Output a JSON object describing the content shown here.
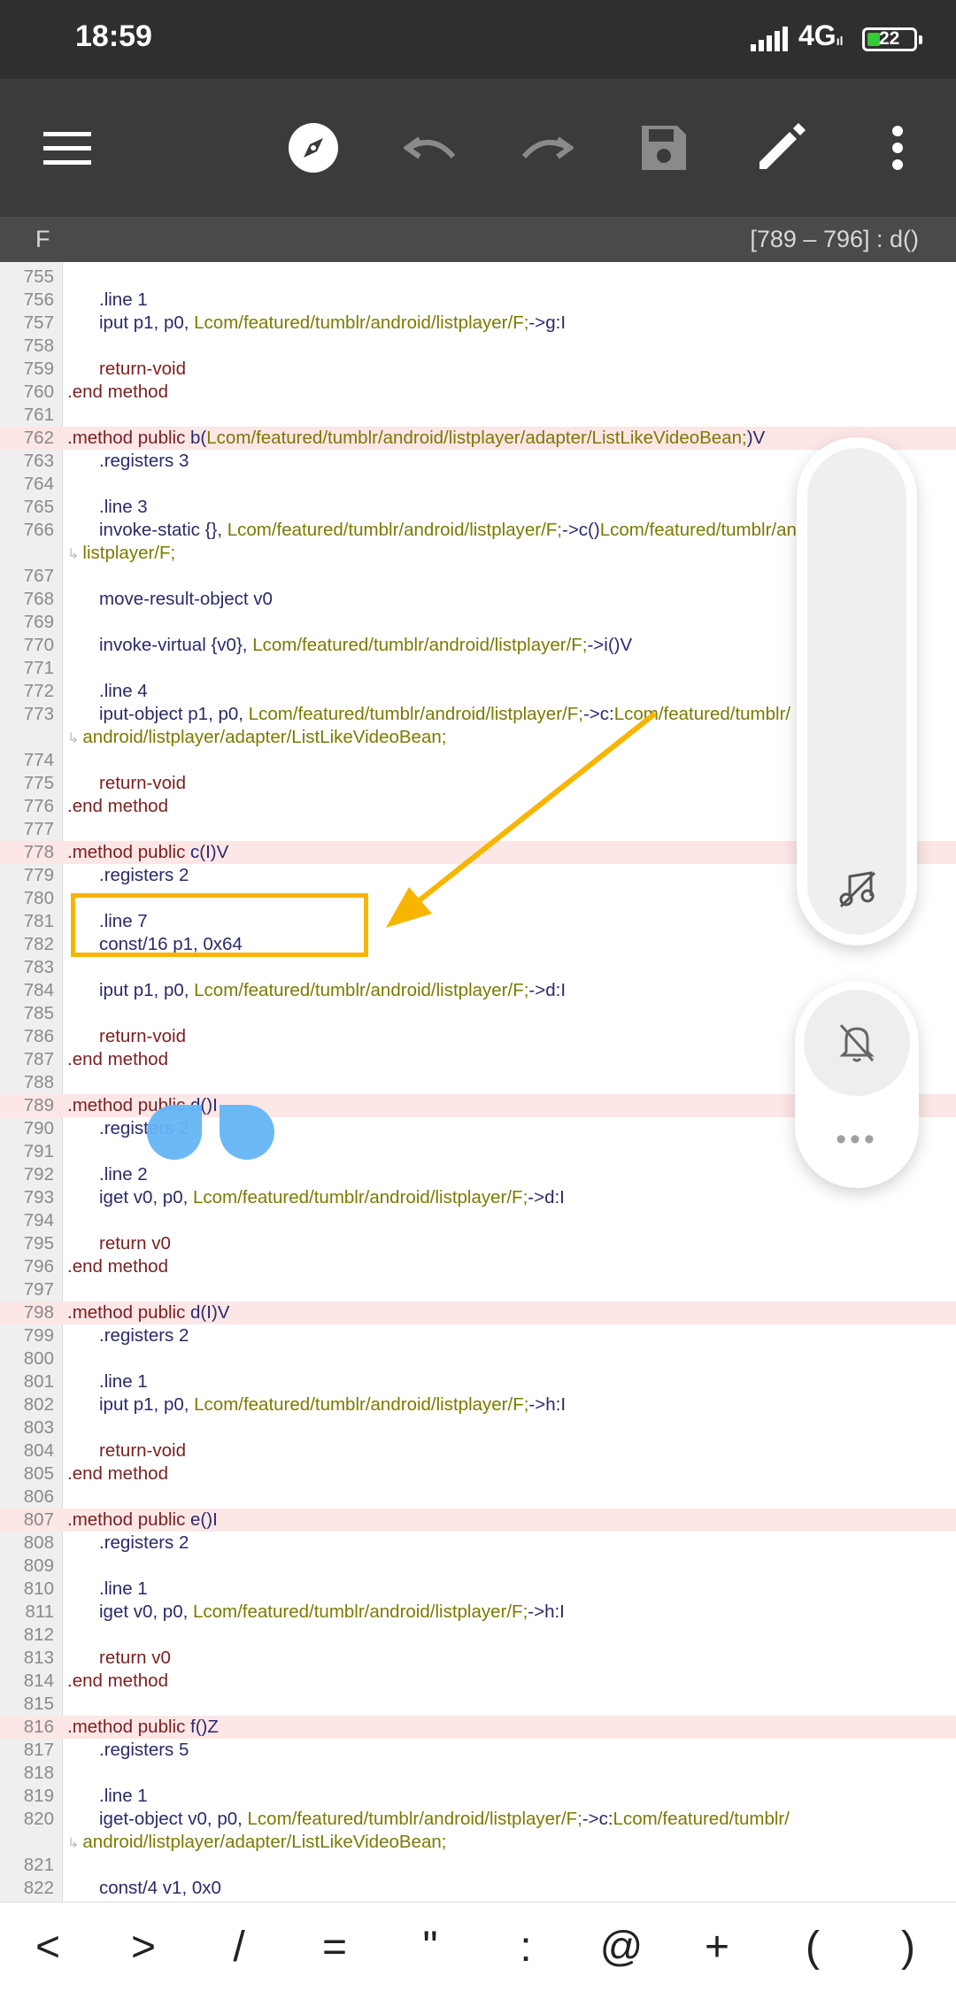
{
  "status": {
    "time": "18:59",
    "network": "4G",
    "network_sub": "ıl",
    "battery": "22"
  },
  "toolbar": {
    "icons": [
      "menu-icon",
      "compass-icon",
      "undo-icon",
      "redo-icon",
      "save-icon",
      "edit-icon",
      "more-vertical-icon"
    ]
  },
  "file": {
    "name": "F",
    "range": "[789 – 796] : d()"
  },
  "code_lines": [
    {
      "n": "755",
      "segs": []
    },
    {
      "n": "756",
      "segs": [
        {
          "t": ".line 1",
          "c": "plain",
          "ind": 1
        }
      ]
    },
    {
      "n": "757",
      "segs": [
        {
          "t": "iput p1, p0, ",
          "c": "plain",
          "ind": 1
        },
        {
          "t": "Lcom/featured/tumblr/android/listplayer/F;",
          "c": "cls"
        },
        {
          "t": "->g:I",
          "c": "plain"
        }
      ]
    },
    {
      "n": "758",
      "segs": []
    },
    {
      "n": "759",
      "segs": [
        {
          "t": "return-void",
          "c": "kw",
          "ind": 1
        }
      ]
    },
    {
      "n": "760",
      "segs": [
        {
          "t": ".end method",
          "c": "kw"
        }
      ]
    },
    {
      "n": "761",
      "segs": []
    },
    {
      "n": "762",
      "hl": true,
      "segs": [
        {
          "t": ".method public ",
          "c": "kw"
        },
        {
          "t": "b(",
          "c": "plain"
        },
        {
          "t": "Lcom/featured/tumblr/android/listplayer/adapter/ListLikeVideoBean;",
          "c": "cls"
        },
        {
          "t": ")V",
          "c": "plain"
        }
      ]
    },
    {
      "n": "763",
      "segs": [
        {
          "t": ".registers 3",
          "c": "plain",
          "ind": 1
        }
      ]
    },
    {
      "n": "764",
      "segs": []
    },
    {
      "n": "765",
      "segs": [
        {
          "t": ".line 3",
          "c": "plain",
          "ind": 1
        }
      ]
    },
    {
      "n": "766",
      "segs": [
        {
          "t": "invoke-static {}, ",
          "c": "plain",
          "ind": 1
        },
        {
          "t": "Lcom/featured/tumblr/android/listplayer/F;",
          "c": "cls"
        },
        {
          "t": "->c()",
          "c": "plain"
        },
        {
          "t": "Lcom/featured/tumblr/android/",
          "c": "cls"
        }
      ]
    },
    {
      "n": "",
      "wrap": true,
      "segs": [
        {
          "t": "listplayer/F;",
          "c": "cls"
        }
      ]
    },
    {
      "n": "767",
      "segs": []
    },
    {
      "n": "768",
      "segs": [
        {
          "t": "move-result-object v0",
          "c": "plain",
          "ind": 1
        }
      ]
    },
    {
      "n": "769",
      "segs": []
    },
    {
      "n": "770",
      "segs": [
        {
          "t": "invoke-virtual {v0}, ",
          "c": "plain",
          "ind": 1
        },
        {
          "t": "Lcom/featured/tumblr/android/listplayer/F;",
          "c": "cls"
        },
        {
          "t": "->i()V",
          "c": "plain"
        }
      ]
    },
    {
      "n": "771",
      "segs": []
    },
    {
      "n": "772",
      "segs": [
        {
          "t": ".line 4",
          "c": "plain",
          "ind": 1
        }
      ]
    },
    {
      "n": "773",
      "segs": [
        {
          "t": "iput-object p1, p0, ",
          "c": "plain",
          "ind": 1
        },
        {
          "t": "Lcom/featured/tumblr/android/listplayer/F;",
          "c": "cls"
        },
        {
          "t": "->c:",
          "c": "plain"
        },
        {
          "t": "Lcom/featured/tumblr/",
          "c": "cls"
        }
      ]
    },
    {
      "n": "",
      "wrap": true,
      "segs": [
        {
          "t": "android/listplayer/adapter/ListLikeVideoBean;",
          "c": "cls"
        }
      ]
    },
    {
      "n": "774",
      "segs": []
    },
    {
      "n": "775",
      "segs": [
        {
          "t": "return-void",
          "c": "kw",
          "ind": 1
        }
      ]
    },
    {
      "n": "776",
      "segs": [
        {
          "t": ".end method",
          "c": "kw"
        }
      ]
    },
    {
      "n": "777",
      "segs": []
    },
    {
      "n": "778",
      "hl": true,
      "segs": [
        {
          "t": ".method public ",
          "c": "kw"
        },
        {
          "t": "c(I)V",
          "c": "plain"
        }
      ]
    },
    {
      "n": "779",
      "segs": [
        {
          "t": ".registers 2",
          "c": "plain",
          "ind": 1
        }
      ]
    },
    {
      "n": "780",
      "segs": []
    },
    {
      "n": "781",
      "segs": [
        {
          "t": ".line 7",
          "c": "plain",
          "ind": 1
        }
      ]
    },
    {
      "n": "782",
      "segs": [
        {
          "t": "const/16 p1, 0x64",
          "c": "plain",
          "ind": 1
        }
      ]
    },
    {
      "n": "783",
      "segs": []
    },
    {
      "n": "784",
      "segs": [
        {
          "t": "iput p1, p0, ",
          "c": "plain",
          "ind": 1
        },
        {
          "t": "Lcom/featured/tumblr/android/listplayer/F;",
          "c": "cls"
        },
        {
          "t": "->d:I",
          "c": "plain"
        }
      ]
    },
    {
      "n": "785",
      "segs": []
    },
    {
      "n": "786",
      "segs": [
        {
          "t": "return-void",
          "c": "kw",
          "ind": 1
        }
      ]
    },
    {
      "n": "787",
      "segs": [
        {
          "t": ".end method",
          "c": "kw"
        }
      ]
    },
    {
      "n": "788",
      "segs": []
    },
    {
      "n": "789",
      "hl": true,
      "segs": [
        {
          "t": ".method public ",
          "c": "kw"
        },
        {
          "t": "d()I",
          "c": "plain"
        }
      ]
    },
    {
      "n": "790",
      "segs": [
        {
          "t": ".registers 2",
          "c": "plain",
          "ind": 1
        }
      ]
    },
    {
      "n": "791",
      "segs": []
    },
    {
      "n": "792",
      "segs": [
        {
          "t": ".line 2",
          "c": "plain",
          "ind": 1
        }
      ]
    },
    {
      "n": "793",
      "segs": [
        {
          "t": "iget v0, p0, ",
          "c": "plain",
          "ind": 1
        },
        {
          "t": "Lcom/featured/tumblr/android/listplayer/F;",
          "c": "cls"
        },
        {
          "t": "->d:I",
          "c": "plain"
        }
      ]
    },
    {
      "n": "794",
      "segs": []
    },
    {
      "n": "795",
      "segs": [
        {
          "t": "return v0",
          "c": "kw",
          "ind": 1
        }
      ]
    },
    {
      "n": "796",
      "segs": [
        {
          "t": ".end method",
          "c": "kw"
        }
      ]
    },
    {
      "n": "797",
      "segs": []
    },
    {
      "n": "798",
      "hl": true,
      "segs": [
        {
          "t": ".method public ",
          "c": "kw"
        },
        {
          "t": "d(I)V",
          "c": "plain"
        }
      ]
    },
    {
      "n": "799",
      "segs": [
        {
          "t": ".registers 2",
          "c": "plain",
          "ind": 1
        }
      ]
    },
    {
      "n": "800",
      "segs": []
    },
    {
      "n": "801",
      "segs": [
        {
          "t": ".line 1",
          "c": "plain",
          "ind": 1
        }
      ]
    },
    {
      "n": "802",
      "segs": [
        {
          "t": "iput p1, p0, ",
          "c": "plain",
          "ind": 1
        },
        {
          "t": "Lcom/featured/tumblr/android/listplayer/F;",
          "c": "cls"
        },
        {
          "t": "->h:I",
          "c": "plain"
        }
      ]
    },
    {
      "n": "803",
      "segs": []
    },
    {
      "n": "804",
      "segs": [
        {
          "t": "return-void",
          "c": "kw",
          "ind": 1
        }
      ]
    },
    {
      "n": "805",
      "segs": [
        {
          "t": ".end method",
          "c": "kw"
        }
      ]
    },
    {
      "n": "806",
      "segs": []
    },
    {
      "n": "807",
      "hl": true,
      "segs": [
        {
          "t": ".method public ",
          "c": "kw"
        },
        {
          "t": "e()I",
          "c": "plain"
        }
      ]
    },
    {
      "n": "808",
      "segs": [
        {
          "t": ".registers 2",
          "c": "plain",
          "ind": 1
        }
      ]
    },
    {
      "n": "809",
      "segs": []
    },
    {
      "n": "810",
      "segs": [
        {
          "t": ".line 1",
          "c": "plain",
          "ind": 1
        }
      ]
    },
    {
      "n": "811",
      "segs": [
        {
          "t": "iget v0, p0, ",
          "c": "plain",
          "ind": 1
        },
        {
          "t": "Lcom/featured/tumblr/android/listplayer/F;",
          "c": "cls"
        },
        {
          "t": "->h:I",
          "c": "plain"
        }
      ]
    },
    {
      "n": "812",
      "segs": []
    },
    {
      "n": "813",
      "segs": [
        {
          "t": "return v0",
          "c": "kw",
          "ind": 1
        }
      ]
    },
    {
      "n": "814",
      "segs": [
        {
          "t": ".end method",
          "c": "kw"
        }
      ]
    },
    {
      "n": "815",
      "segs": []
    },
    {
      "n": "816",
      "hl": true,
      "segs": [
        {
          "t": ".method public ",
          "c": "kw"
        },
        {
          "t": "f()Z",
          "c": "plain"
        }
      ]
    },
    {
      "n": "817",
      "segs": [
        {
          "t": ".registers 5",
          "c": "plain",
          "ind": 1
        }
      ]
    },
    {
      "n": "818",
      "segs": []
    },
    {
      "n": "819",
      "segs": [
        {
          "t": ".line 1",
          "c": "plain",
          "ind": 1
        }
      ]
    },
    {
      "n": "820",
      "segs": [
        {
          "t": "iget-object v0, p0, ",
          "c": "plain",
          "ind": 1
        },
        {
          "t": "Lcom/featured/tumblr/android/listplayer/F;",
          "c": "cls"
        },
        {
          "t": "->c:",
          "c": "plain"
        },
        {
          "t": "Lcom/featured/tumblr/",
          "c": "cls"
        }
      ]
    },
    {
      "n": "",
      "wrap": true,
      "segs": [
        {
          "t": "android/listplayer/adapter/ListLikeVideoBean;",
          "c": "cls"
        }
      ]
    },
    {
      "n": "821",
      "segs": []
    },
    {
      "n": "822",
      "segs": [
        {
          "t": "const/4 v1, 0x0",
          "c": "plain",
          "ind": 1
        }
      ]
    },
    {
      "n": "823",
      "segs": []
    }
  ],
  "floating": {
    "tall_icon": "music-off-icon",
    "bell_icon": "bell-off-icon",
    "dots": "•••"
  },
  "symbols": [
    "<",
    ">",
    "/",
    "=",
    "\"",
    ":",
    "@",
    "+",
    "(",
    ")"
  ],
  "colors": {
    "toolbar": "#3b3b3b",
    "highlight": "#fde6e6",
    "annotation": "#f7b500",
    "handle": "#64b5f6"
  }
}
